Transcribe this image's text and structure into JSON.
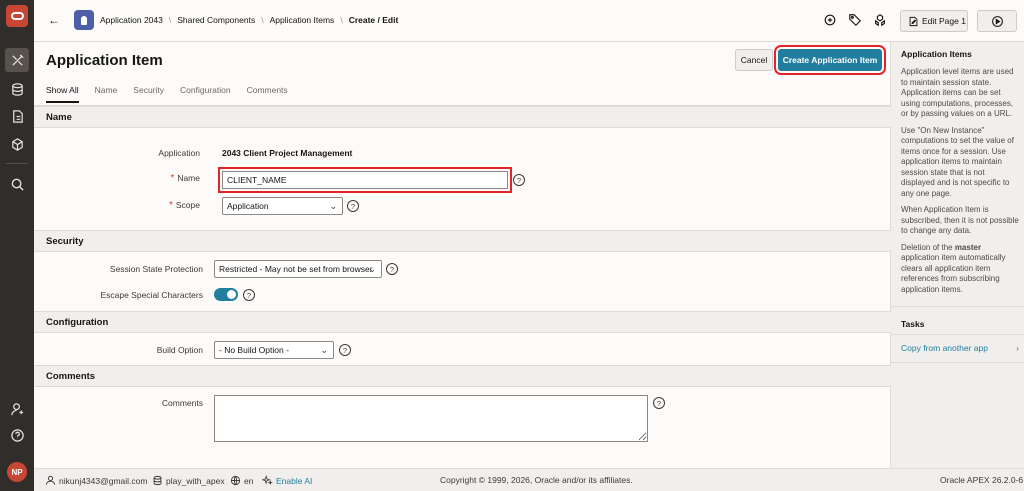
{
  "rail": {
    "avatar_initials": "NP"
  },
  "topbar": {
    "breadcrumbs": [
      "Application 2043",
      "Shared Components",
      "Application Items",
      "Create / Edit"
    ],
    "edit_page_label": "Edit Page 1"
  },
  "main": {
    "title": "Application Item",
    "cancel_label": "Cancel",
    "create_label": "Create Application Item",
    "tabs": [
      "Show All",
      "Name",
      "Security",
      "Configuration",
      "Comments"
    ],
    "sections": {
      "name": {
        "heading": "Name",
        "application_label": "Application",
        "application_value": "2043 Client Project Management",
        "name_label": "Name",
        "name_value": "CLIENT_NAME",
        "scope_label": "Scope",
        "scope_value": "Application"
      },
      "security": {
        "heading": "Security",
        "ssp_label": "Session State Protection",
        "ssp_value": "Restricted - May not be set from browser",
        "escape_label": "Escape Special Characters",
        "escape_on": true
      },
      "configuration": {
        "heading": "Configuration",
        "build_label": "Build Option",
        "build_value": "- No Build Option -"
      },
      "comments": {
        "heading": "Comments",
        "comments_label": "Comments"
      }
    }
  },
  "sidebar": {
    "heading": "Application Items",
    "p1": "Application level items are used to maintain session state. Application items can be set using computations, processes, or by passing values on a URL.",
    "p2": "Use \"On New Instance\" computations to set the value of items once for a session. Use application items to maintain session state that is not displayed and is not specific to any one page.",
    "p3": "When Application Item is subscribed, then it is not possible to change any data.",
    "p4_pre": "Deletion of the ",
    "p4_bold": "master",
    "p4_post": " application item automatically clears all application item references from subscribing application items.",
    "tasks_heading": "Tasks",
    "task_link": "Copy from another app"
  },
  "footer": {
    "email": "nikunj4343@gmail.com",
    "workspace": "play_with_apex",
    "language": "en",
    "enable_ai": "Enable AI",
    "copyright": "Copyright © 1999, 2026, Oracle and/or its affiliates.",
    "version": "Oracle APEX 26.2.0-6"
  },
  "help_glyph": "?"
}
